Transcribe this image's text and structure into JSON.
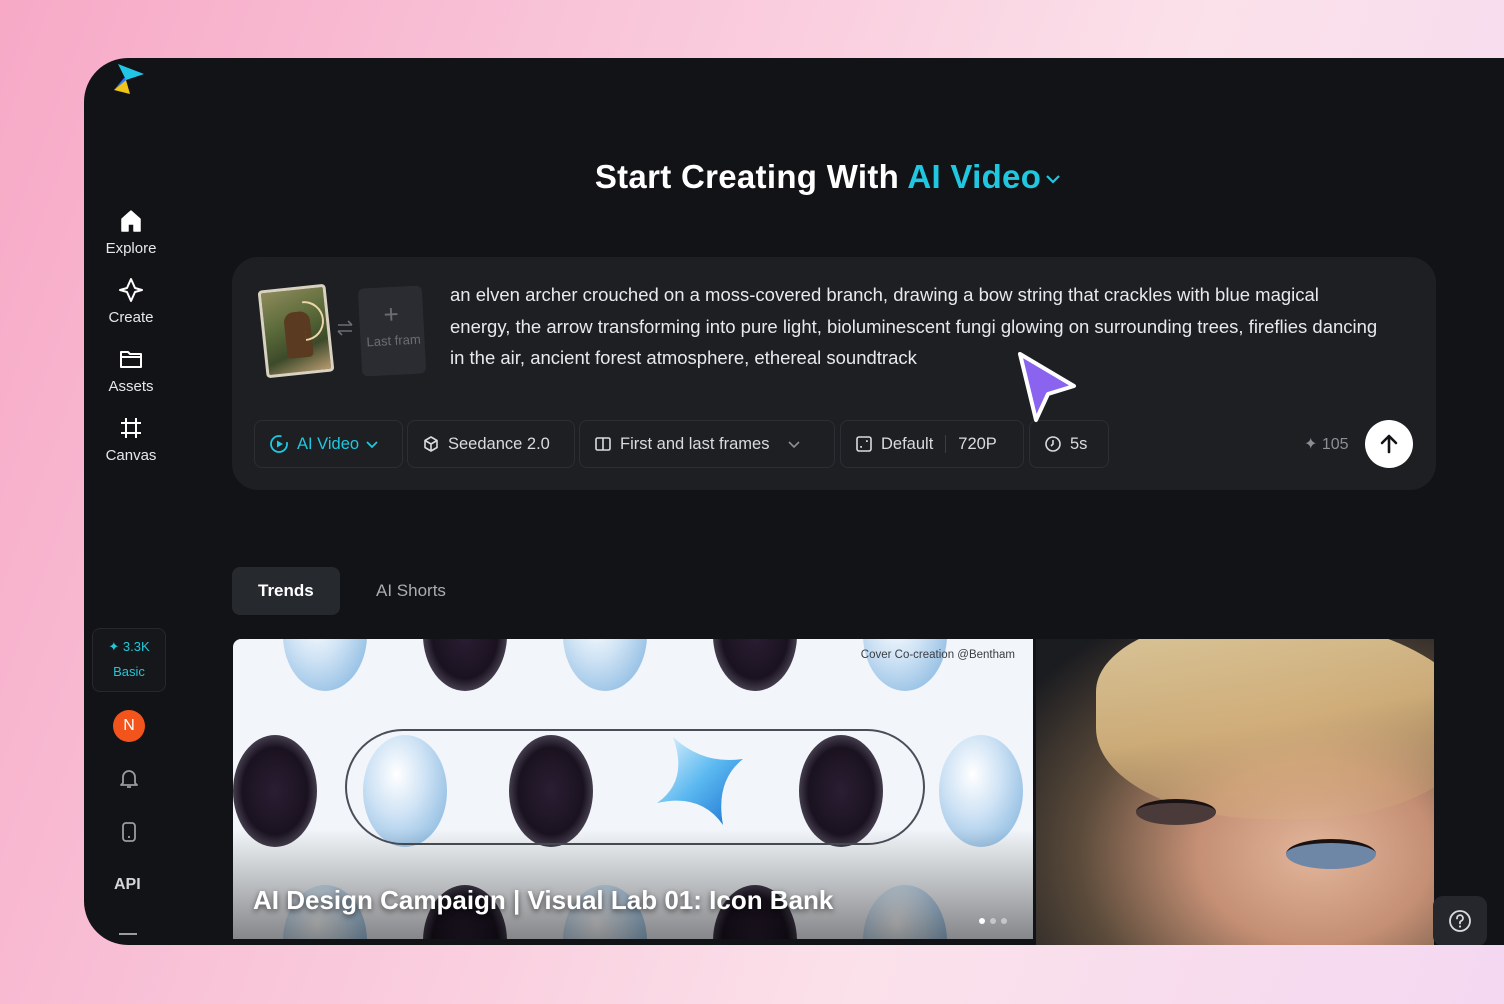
{
  "sidebar": {
    "nav": [
      {
        "label": "Explore",
        "icon": "home-icon"
      },
      {
        "label": "Create",
        "icon": "sparkle-icon"
      },
      {
        "label": "Assets",
        "icon": "folder-icon"
      },
      {
        "label": "Canvas",
        "icon": "canvas-icon"
      }
    ],
    "credits": {
      "amount": "3.3K",
      "plan": "Basic"
    },
    "avatar_initial": "N",
    "api_label": "API"
  },
  "header": {
    "title_prefix": "Start Creating With",
    "title_accent": "AI Video"
  },
  "prompt": {
    "text": "an elven archer crouched on a moss-covered branch, drawing a bow string that crackles with blue magical energy, the arrow transforming into pure light, bioluminescent fungi glowing on surrounding trees, fireflies dancing in the air, ancient forest atmosphere, ethereal soundtrack",
    "last_frame_label": "Last fram",
    "toolbar": {
      "mode": "AI Video",
      "model": "Seedance 2.0",
      "frames_mode": "First and last frames",
      "ratio": "Default",
      "resolution": "720P",
      "duration": "5s",
      "cost": "105"
    }
  },
  "tabs": [
    {
      "label": "Trends",
      "active": true
    },
    {
      "label": "AI Shorts",
      "active": false
    }
  ],
  "gallery": {
    "main_card": {
      "title": "AI Design Campaign | Visual Lab 01: Icon Bank",
      "credit": "Cover Co-creation @Bentham"
    }
  },
  "colors": {
    "accent": "#1fc8e0",
    "panel": "#1d1f23",
    "background": "#121316",
    "avatar": "#f2541b"
  }
}
